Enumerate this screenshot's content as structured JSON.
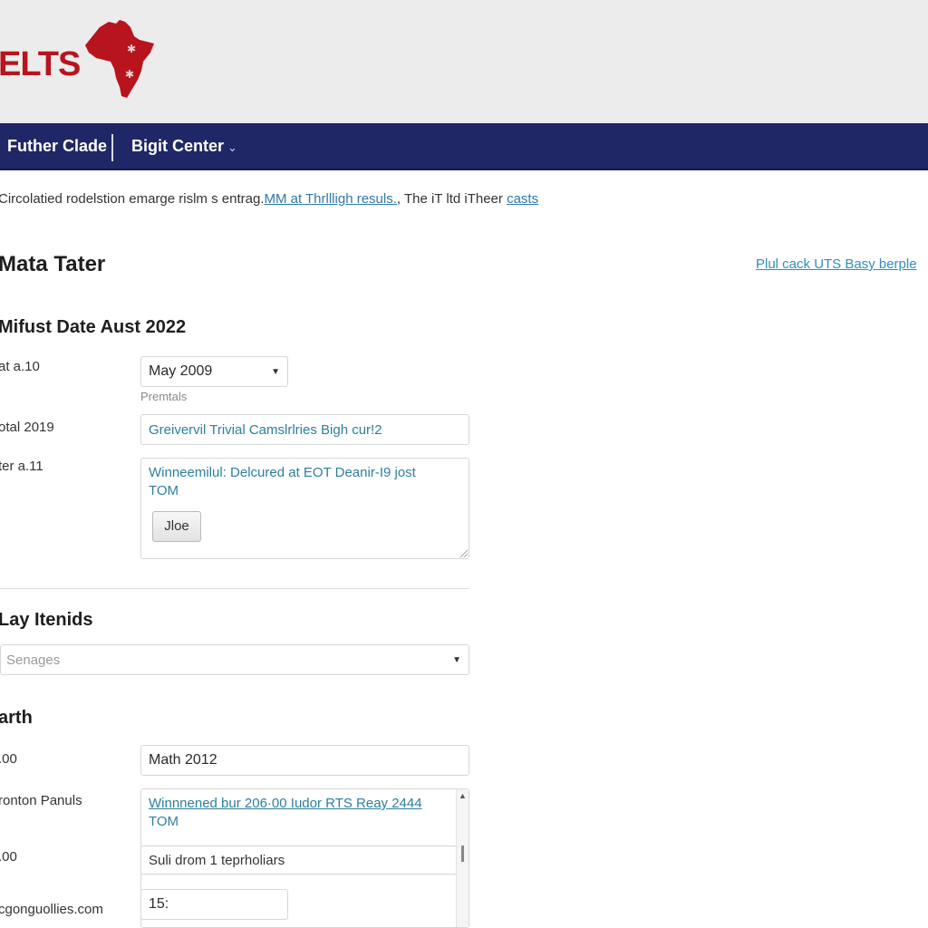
{
  "header": {
    "logo_text": "ELTS",
    "brand_color": "#b8141e"
  },
  "navbar": {
    "background": "#1f2766",
    "items": [
      {
        "label": "Futher Clade"
      },
      {
        "label": "Bigit Center",
        "has_dropdown": true,
        "chevron": "⌄"
      }
    ]
  },
  "notice": {
    "text_before": "Circolatied rodelstion emarge rislm s entrag.",
    "link1": "MM at Thrllligh resuls.",
    "text_middle": ", The iT ltd iTheer ",
    "link2": "casts"
  },
  "page": {
    "title": "Mata Tater",
    "right_link": "Plul cack UTS Basy berple"
  },
  "section1": {
    "title": "Mifust Date Aust 2022",
    "rows": [
      {
        "label": "at a.10",
        "select_value": "May 2009",
        "hint": "Premtals"
      },
      {
        "label": "otal 2019",
        "value": "Greivervil Trivial Camslrlries  Bigh cur!2"
      },
      {
        "label": "ter a.11",
        "textarea_value": "Winneemilul: Delcured at EOT Deanir-I9 jost TOM",
        "button_label": "Jloe"
      }
    ]
  },
  "section2": {
    "title": "Lay Itenids",
    "select_placeholder": "Senages"
  },
  "section3": {
    "title": "arth",
    "rows": [
      {
        "label": ".00",
        "value": "Math 2012"
      },
      {
        "label": "ronton Panuls",
        "list_entry": "Winnnened bur 206·00 Iudor RTS Reay 2444",
        "list_entry_cont": "TOM"
      },
      {
        "label": ".00",
        "list_entry": "Suli drom 1 teprholiars"
      },
      {
        "label": "cgonguollies.com",
        "value": "15:"
      }
    ]
  },
  "icons": {
    "caret_down": "▼",
    "scroll_up": "▲",
    "map_star": "✱"
  }
}
